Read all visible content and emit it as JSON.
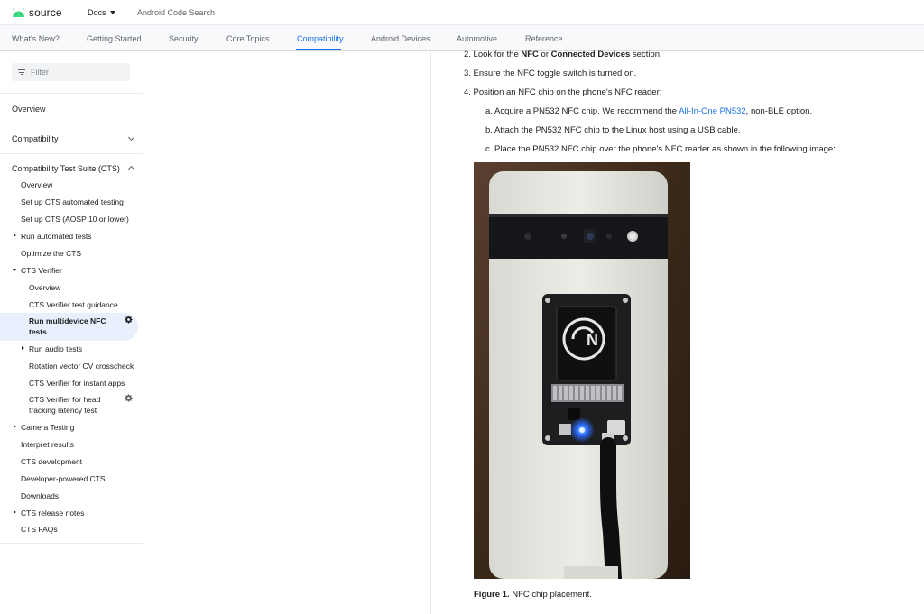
{
  "header": {
    "logo_text": "source",
    "docs_label": "Docs",
    "code_search_label": "Android Code Search"
  },
  "tabs": [
    {
      "label": "What's New?"
    },
    {
      "label": "Getting Started"
    },
    {
      "label": "Security"
    },
    {
      "label": "Core Topics"
    },
    {
      "label": "Compatibility"
    },
    {
      "label": "Android Devices"
    },
    {
      "label": "Automotive"
    },
    {
      "label": "Reference"
    }
  ],
  "active_tab": "Compatibility",
  "sidebar": {
    "filter_placeholder": "Filter",
    "overview": "Overview",
    "compatibility": "Compatibility",
    "cts_heading": "Compatibility Test Suite (CTS)",
    "items": [
      "Overview",
      "Set up CTS automated testing",
      "Set up CTS (AOSP 10 or lower)",
      "Run automated tests",
      "Optimize the CTS",
      "CTS Verifier",
      "Overview",
      "CTS Verifier test guidance",
      "Run multidevice NFC tests",
      "Run audio tests",
      "Rotation vector CV crosscheck",
      "CTS Verifier for instant apps",
      "CTS Verifier for head tracking latency test",
      "Camera Testing",
      "Interpret results",
      "CTS development",
      "Developer-powered CTS",
      "Downloads",
      "CTS release notes",
      "CTS FAQs"
    ],
    "active_item_line1": "Run multidevice NFC",
    "active_item_line2": "tests",
    "head_item_line1": "CTS Verifier for head",
    "head_item_line2": "tracking latency test"
  },
  "content": {
    "step2_prefix": "2. Look for the ",
    "step2_b1": "NFC",
    "step2_mid": " or ",
    "step2_b2": "Connected Devices",
    "step2_suffix": " section.",
    "step3": "3. Ensure the NFC toggle switch is turned on.",
    "step4": "4. Position an NFC chip on the phone's NFC reader:",
    "sub_a_prefix": "a. Acquire a PN532 NFC chip. We recommend the ",
    "sub_a_link": "All-In-One PN532",
    "sub_a_suffix": ", non-BLE option.",
    "sub_b": "b. Attach the PN532 NFC chip to the Linux host using a USB cable.",
    "sub_c": "c. Place the PN532 NFC chip over the phone's NFC reader as shown in the following image:",
    "caption_bold": "Figure 1.",
    "caption_text": " NFC chip placement."
  },
  "colors": {
    "accent": "#1a73e8",
    "active_bg": "#e8f0fe",
    "android_green": "#3ddc84"
  }
}
